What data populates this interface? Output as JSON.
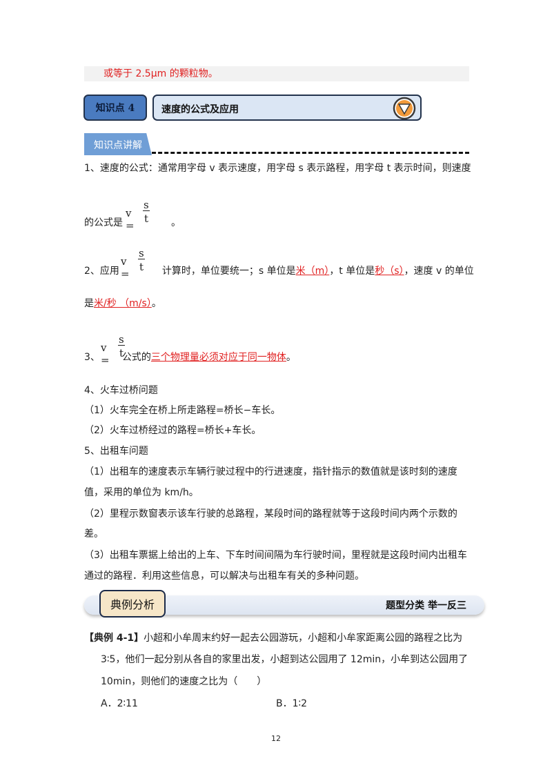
{
  "top_strip": {
    "text": "或等于 2.5μm 的颗粒物。"
  },
  "knowledge_point": {
    "badge": "知识点 4",
    "title": "速度的公式及应用"
  },
  "section_tab": {
    "label": "知识点讲解"
  },
  "formula": {
    "lhs": "v =",
    "num": "s",
    "den": "t"
  },
  "items": {
    "i1_a": "1、速度的公式：通常用字母 v 表示速度，用字母 s 表示路程，用字母 t 表示时间，则速度",
    "i1_b": "的公式是",
    "i1_c": "。",
    "i2_a": "2、应用",
    "i2_b": "计算时，单位要统一；s 单位是",
    "i2_c": "米（m）",
    "i2_d": "，t 单位是",
    "i2_e": "秒（s）",
    "i2_f": "，速度 v 的单位",
    "i2_g": "是",
    "i2_h": "米/秒 （m/s）",
    "i2_i": "。",
    "i3_a": "3、",
    "i3_b": "公式的",
    "i3_c": "三个物理量必须对应于同一物体",
    "i3_d": "。",
    "i4": "4、火车过桥问题",
    "i4_1": "（1）火车完全在桥上所走路程=桥长−车长。",
    "i4_2": "（2）火车过桥经过的路程=桥长+车长。",
    "i5": "5、出租车问题",
    "i5_1a": "（1）出租车的速度表示车辆行驶过程中的行进速度，指针指示的数值就是该时刻的速度",
    "i5_1b": "值，采用的单位为 km/h。",
    "i5_2a": "（2）里程示数窗表示该车行驶的总路程，某段时间的路程就等于这段时间内两个示数的",
    "i5_2b": "差。",
    "i5_3a": "（3）出租车票据上给出的上车、下车时间间隔为车行驶时间，里程就是这段时间内出租车",
    "i5_3b": "通过的路程．利用这些信息，可以解决与出租车有关的多种问题。"
  },
  "banner": {
    "label": "典例分析",
    "right": "题型分类  举一反三"
  },
  "example": {
    "tag": "【典例 4-1】",
    "line1": "小超和小牟周末约好一起去公园游玩，小超和小牟家距离公园的路程之比为",
    "line2": "3∶5，他们一起分别从各自的家里出发，小超到达公园用了 12min，小牟到达公园用了",
    "line3": "10min，则他们的速度之比为（　　）",
    "optA": "A．2∶11",
    "optB": "B．1∶2"
  },
  "page_number": "12",
  "colors": {
    "accent_red": "#e02020",
    "badge_blue": "#4a7bc0",
    "tab_blue": "#6f9ed6",
    "icon_orange": "#f29a3a"
  }
}
